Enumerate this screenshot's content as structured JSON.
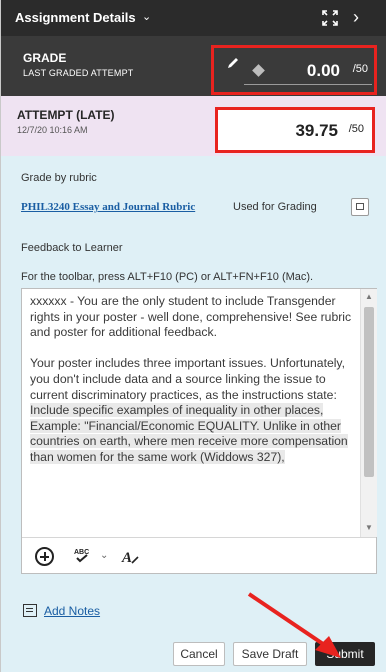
{
  "header": {
    "title": "Assignment Details",
    "title_menu_icon": "chevron-down-icon",
    "expand_icon": "expand-icon",
    "next_icon": "chevron-right-icon"
  },
  "grade": {
    "label": "GRADE",
    "sublabel": "LAST GRADED ATTEMPT",
    "value": "0.00",
    "out_of": "/50",
    "edit_icon": "pencil-icon",
    "indicator_icon": "diamond-icon"
  },
  "attempt": {
    "label": "ATTEMPT (LATE)",
    "date": "12/7/20 10:16 AM",
    "value": "39.75",
    "out_of": "/50"
  },
  "rubric": {
    "section_label": "Grade by rubric",
    "link_text": "PHIL3240 Essay and Journal Rubric",
    "status": "Used for Grading",
    "view_icon": "rubric-view-icon"
  },
  "feedback": {
    "section_label": "Feedback to Learner",
    "toolbar_hint": "For the toolbar, press ALT+F10 (PC) or ALT+FN+F10 (Mac).",
    "paragraph1": "xxxxxx - You are the only student to include Transgender rights in your poster - well done, comprehensive! See rubric and poster for additional feedback.",
    "paragraph2_plain": "Your poster includes three important issues. Unfortunately, you don't include data and a source linking the issue to current discriminatory practices, as the instructions state: ",
    "paragraph2_highlight": "Include specific examples of inequality in other places, Example: \"Financial/Economic EQUALITY. Unlike in other countries on earth, where men receive more compensation than women for the same work (Widdows 327),",
    "toolbar_icons": [
      "add-content-icon",
      "spellcheck-icon",
      "chevron-down-icon",
      "text-format-icon"
    ]
  },
  "notes": {
    "link_text": "Add Notes",
    "icon": "notes-icon"
  },
  "actions": {
    "cancel": "Cancel",
    "save_draft": "Save Draft",
    "submit": "Submit"
  },
  "colors": {
    "header_bg": "#2b2b2b",
    "grade_bg": "#3a3a3a",
    "attempt_bg": "#efe3f2",
    "panel_bg": "#dff0f6",
    "highlight_border": "#e8231f",
    "link": "#1a5ea3",
    "submit_bg": "#262626"
  }
}
